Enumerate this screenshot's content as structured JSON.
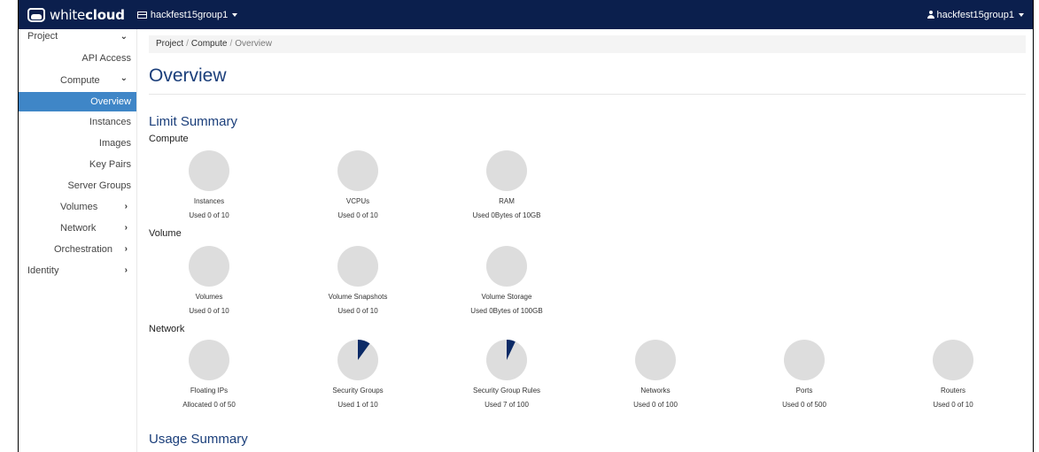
{
  "brand": {
    "prefix": "white",
    "suffix": "cloud"
  },
  "project": "hackfest15group1",
  "user": "hackfest15group1",
  "sidebar": {
    "project": "Project",
    "api_access": "API Access",
    "compute": "Compute",
    "overview": "Overview",
    "instances": "Instances",
    "images": "Images",
    "key_pairs": "Key Pairs",
    "server_groups": "Server Groups",
    "volumes": "Volumes",
    "network": "Network",
    "orchestration": "Orchestration",
    "identity": "Identity"
  },
  "breadcrumb": [
    "Project",
    "Compute",
    "Overview"
  ],
  "page_title": "Overview",
  "limit_summary": "Limit Summary",
  "usage_summary": "Usage Summary",
  "groups": {
    "compute": {
      "title": "Compute",
      "items": [
        {
          "label": "Instances",
          "used": "Used 0 of 10",
          "fraction": 0
        },
        {
          "label": "VCPUs",
          "used": "Used 0 of 10",
          "fraction": 0
        },
        {
          "label": "RAM",
          "used": "Used 0Bytes of 10GB",
          "fraction": 0
        }
      ]
    },
    "volume": {
      "title": "Volume",
      "items": [
        {
          "label": "Volumes",
          "used": "Used 0 of 10",
          "fraction": 0
        },
        {
          "label": "Volume Snapshots",
          "used": "Used 0 of 10",
          "fraction": 0
        },
        {
          "label": "Volume Storage",
          "used": "Used 0Bytes of 100GB",
          "fraction": 0
        }
      ]
    },
    "network": {
      "title": "Network",
      "items": [
        {
          "label": "Floating IPs",
          "used": "Allocated 0 of 50",
          "fraction": 0
        },
        {
          "label": "Security Groups",
          "used": "Used 1 of 10",
          "fraction": 0.1
        },
        {
          "label": "Security Group Rules",
          "used": "Used 7 of 100",
          "fraction": 0.07
        },
        {
          "label": "Networks",
          "used": "Used 0 of 100",
          "fraction": 0
        },
        {
          "label": "Ports",
          "used": "Used 0 of 500",
          "fraction": 0
        },
        {
          "label": "Routers",
          "used": "Used 0 of 10",
          "fraction": 0
        }
      ]
    }
  },
  "colors": {
    "navbar": "#0b1f4d",
    "pie_bg": "#dddddd",
    "pie_fill": "#0b2a66",
    "accent": "#1a3e7a",
    "active": "#3f86c7"
  }
}
